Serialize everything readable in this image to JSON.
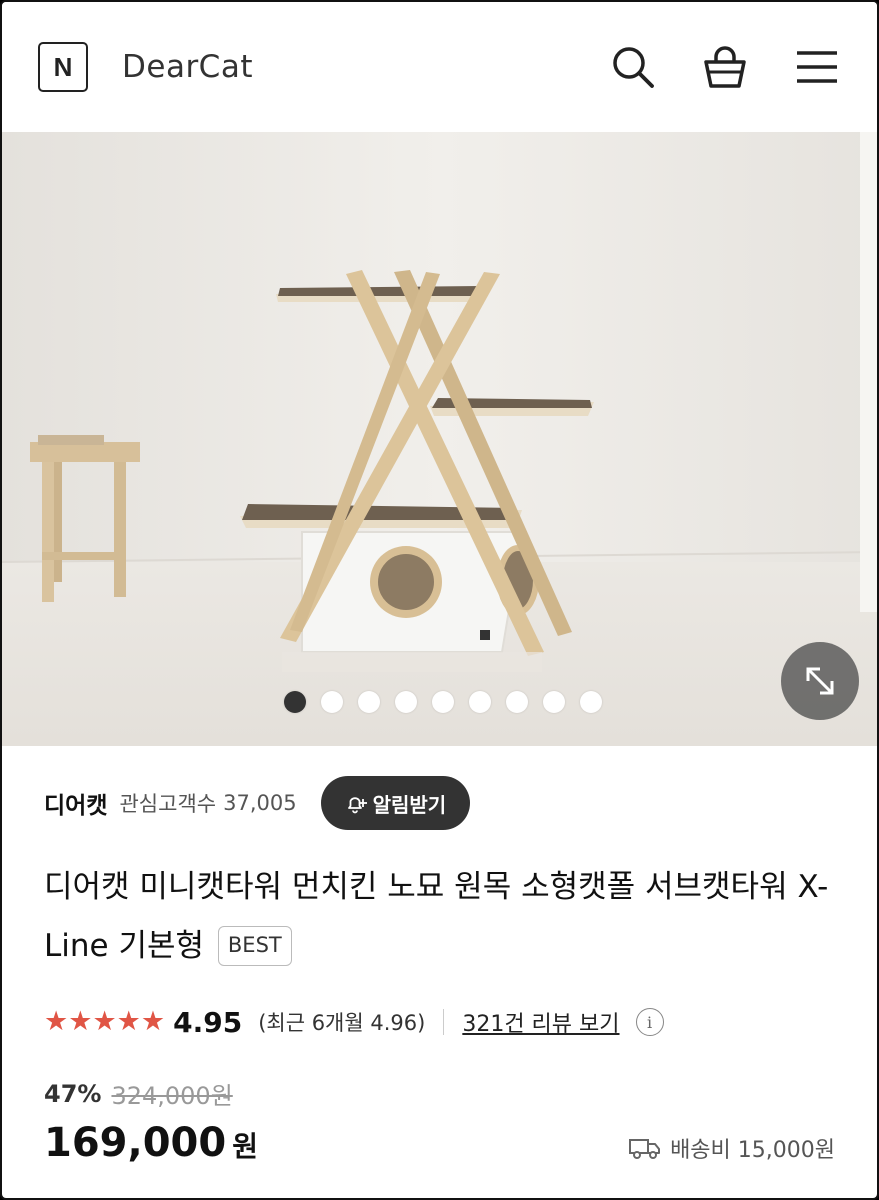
{
  "header": {
    "logo_letter": "N",
    "brand": "DearCat",
    "icons": [
      "search-icon",
      "cart-icon",
      "menu-icon"
    ]
  },
  "gallery": {
    "slide_count": 9,
    "active_index": 0
  },
  "seller": {
    "name": "디어캣",
    "follower_label": "관심고객수",
    "follower_count": "37,005",
    "alarm_button": "알림받기"
  },
  "product": {
    "title": "디어캣 미니캣타워 먼치킨 노묘 원목 소형캣폴 서브캣타워 X-Line 기본형",
    "badge": "BEST",
    "stars": 5,
    "rating": "4.95",
    "recent_rating": "(최근 6개월 4.96)",
    "review_link": "321건 리뷰 보기",
    "discount": "47%",
    "original_price": "324,000원",
    "price": "169,000",
    "price_unit": "원",
    "shipping": "배송비 15,000원"
  },
  "colors": {
    "star": "#e05545",
    "alarm_button_bg": "#333333"
  }
}
